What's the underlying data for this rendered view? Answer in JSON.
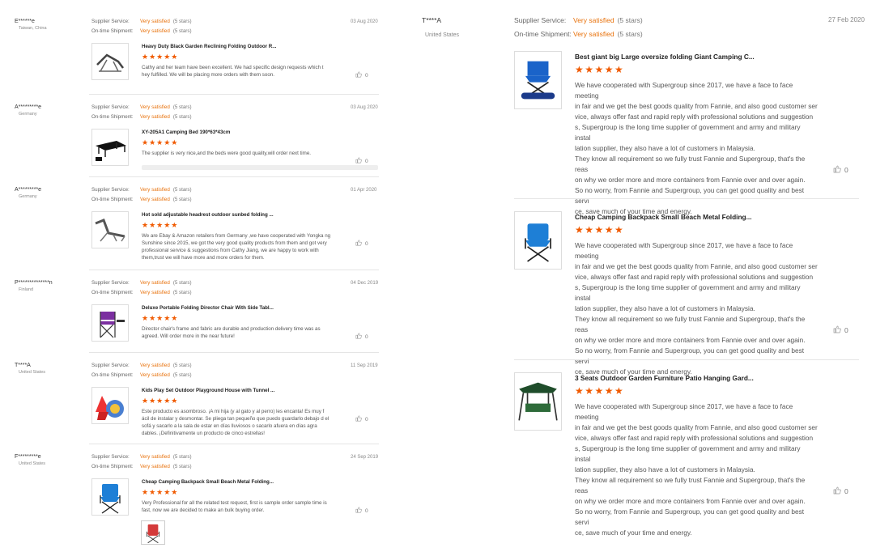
{
  "labels": {
    "supplier_service": "Supplier Service:",
    "on_time_shipment": "On-time Shipment:",
    "very_satisfied": "Very satisfied",
    "five_stars": "(5 stars)",
    "stars_glyph": "★★★★★"
  },
  "left_reviews": [
    {
      "user": "E******e",
      "country": "Taiwan, China",
      "date": "03 Aug 2020",
      "product": "Heavy Duty Black Garden Reclining Folding Outdoor R...",
      "text": "Cathy and her team have been excellent. We had specific design requests which t hey fulfilled. We will be placing more orders with them soon.",
      "likes": "0",
      "icon": "recliner-chair-icon"
    },
    {
      "user": "A*********e",
      "country": "Germany",
      "date": "03 Aug 2020",
      "product": "XY-205A1 Camping Bed 190*63*43cm",
      "text": "The supplier is very nice,and the beds were good quality,will order next time.",
      "likes": "0",
      "icon": "camping-bed-icon"
    },
    {
      "user": "A*********e",
      "country": "Germany",
      "date": "01 Apr 2020",
      "product": "Hot sold adjustable headrest outdoor sunbed folding ...",
      "text": "We are Ebay & Amazon retailers from Germany ,we have cooperated with Yongka ng Sunshine since 2015, we got the very good quality products from them and got very professional service & suggestions from Cathy Jiang, we are happy to work with them,trust we will have more and more orders for them.",
      "likes": "0",
      "icon": "sunbed-icon"
    },
    {
      "user": "P**************n",
      "country": "Finland",
      "date": "04 Dec 2019",
      "product": "Deluxe Portable Folding Director Chair With Side Tabl...",
      "text": "Director chair's frame and fabric are durable and production delivery time was as agreed. Will order more in the near future!",
      "likes": "0",
      "icon": "director-chair-icon"
    },
    {
      "user": "T****A",
      "country": "United States",
      "date": "11 Sep 2019",
      "product": "Kids Play Set Outdoor Playground House with Tunnel ...",
      "text": "Este producto es asombroso. ¡A mi hija (y al gato y al perro) les encanta! Es muy f ácil de instalar y desmontar. Se pliega tan pequeño que puedo guardarlo debajo d el sofá y sacarlo a la sala de estar en días lluviosos o sacarlo afuera en días agra dables. ¡Definitivamente un producto de cinco estrellas!",
      "likes": "0",
      "icon": "play-tunnel-icon"
    },
    {
      "user": "F*********e",
      "country": "United States",
      "date": "24 Sep 2019",
      "product": "Cheap Camping Backpack Small Beach Metal Folding...",
      "text": "Very Professional for all the related test request, first is sample order sample time is fast, now we are decided to make an bulk buying order.",
      "likes": "0",
      "icon": "blue-folding-chair-icon"
    }
  ],
  "right_review": {
    "user": "T****A",
    "country": "United States",
    "date": "27 Feb 2020",
    "items": [
      {
        "product": "Best giant big Large oversize folding Giant Camping C...",
        "likes": "0",
        "icon": "giant-camping-chair-icon"
      },
      {
        "product": "Cheap Camping Backpack Small Beach Metal Folding...",
        "likes": "0",
        "icon": "blue-folding-chair-icon"
      },
      {
        "product": "3 Seats Outdoor Garden Furniture Patio Hanging Gard...",
        "likes": "0",
        "icon": "garden-swing-icon"
      }
    ],
    "text_lines": [
      "We have cooperated with Supergroup since 2017, we have a face to face meeting",
      "in fair and we get the best goods quality from Fannie, and also good customer ser",
      "vice, always offer fast and rapid reply with professional solutions and suggestion",
      "s, Supergroup is the long time supplier of government and army and military instal",
      "lation supplier, they also have a lot of customers in Malaysia.",
      "They know all requirement so we fully trust Fannie and Supergroup, that's the reas",
      "on why we order more and more containers from Fannie over and over again.",
      "So no worry, from Fannie and Supergroup, you can get good quality and best servi",
      "ce, save much of your time and energy."
    ]
  },
  "colors": {
    "accent": "#e8720c",
    "stars": "#f05a00"
  }
}
